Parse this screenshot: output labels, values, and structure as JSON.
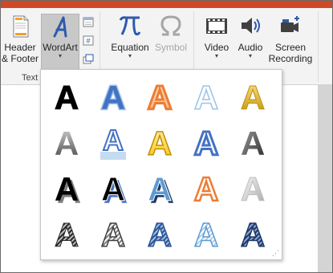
{
  "ribbon": {
    "header_footer": {
      "label_line1": "Header",
      "label_line2": "& Footer",
      "icon": "header-footer-icon"
    },
    "wordart": {
      "label": "WordArt",
      "icon": "wordart-icon"
    },
    "text_group_label": "Text",
    "equation": {
      "label": "Equation",
      "icon": "pi-icon"
    },
    "symbol": {
      "label": "Symbol",
      "icon": "omega-icon",
      "disabled": true
    },
    "video": {
      "label": "Video",
      "icon": "film-strip-icon"
    },
    "audio": {
      "label": "Audio",
      "icon": "speaker-icon"
    },
    "screen_recording": {
      "label_line1": "Screen",
      "label_line2": "Recording",
      "icon": "screen-recording-icon"
    }
  },
  "gallery": {
    "letter": "A",
    "styles": [
      [
        "solid-black-white-outline",
        "blue-soft-glow",
        "orange-gradient-outline",
        "light-blue-outline",
        "gold-gradient"
      ],
      [
        "gray-gradient",
        "blue-reflection",
        "yellow-gold-outline",
        "blue-outline-white-fill",
        "dark-gray-gradient"
      ],
      [
        "black-shadow",
        "black-shadow-blue",
        "blue-shadow",
        "orange-outline-white",
        "silver-bevel"
      ],
      [
        "black-pattern",
        "gray-pattern",
        "blue-pattern",
        "light-blue-pattern",
        "navy-pattern"
      ]
    ],
    "resize_grip": "⋰"
  },
  "colors": {
    "accent_titlebar": "#d24726",
    "wordart_blue": "#2e5aac",
    "gallery_blue": "#4472c4",
    "gallery_orange": "#ed7d31",
    "gallery_gold": "#ffc000"
  }
}
